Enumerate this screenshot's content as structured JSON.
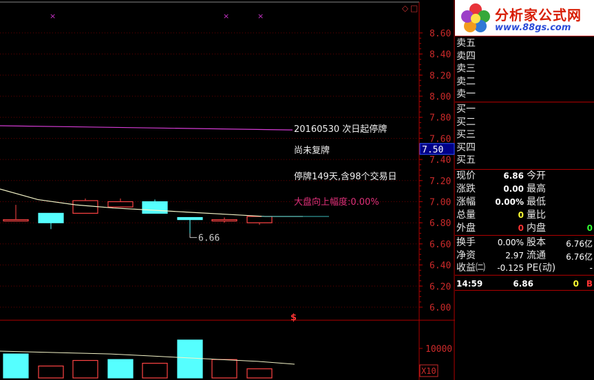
{
  "chart": {
    "price_axis": [
      "8.60",
      "8.40",
      "8.20",
      "8.00",
      "7.80",
      "7.60",
      "7.40",
      "7.20",
      "7.00",
      "6.80",
      "6.60",
      "6.40",
      "6.20",
      "6.00"
    ],
    "current_price_tag": "7.50",
    "volume_axis_label": "10000",
    "volume_scale": "X10",
    "low_marker": "6.66",
    "annotations": {
      "suspend_date": "20160530 次日起停牌",
      "not_resumed": "尚未复牌",
      "suspend_days": "停牌149天,含98个交易日",
      "market_change": "大盘向上幅度:0.00%"
    },
    "markers": [
      "×",
      "×",
      "×"
    ],
    "dollar_mark": "$",
    "corner_icons": [
      "◇",
      "□"
    ]
  },
  "chart_data": {
    "type": "candlestick",
    "candles": [
      {
        "open": 6.83,
        "close": 6.83,
        "high": 6.97,
        "low": 6.83
      },
      {
        "open": 6.89,
        "close": 6.8,
        "high": 6.89,
        "low": 6.74
      },
      {
        "open": 6.89,
        "close": 7.01,
        "high": 7.03,
        "low": 6.89
      },
      {
        "open": 6.95,
        "close": 7.0,
        "high": 7.03,
        "low": 6.95
      },
      {
        "open": 7.0,
        "close": 6.89,
        "high": 7.02,
        "low": 6.89
      },
      {
        "open": 6.85,
        "close": 6.83,
        "high": 6.85,
        "low": 6.66
      },
      {
        "open": 6.82,
        "close": 6.83,
        "high": 6.85,
        "low": 6.8
      },
      {
        "open": 6.8,
        "close": 6.86,
        "high": 6.86,
        "low": 6.78
      }
    ],
    "ma_long": {
      "start": 7.72,
      "end": 7.68
    },
    "ma_short": [
      7.12,
      7.02,
      6.97,
      6.94,
      6.92,
      6.9,
      6.88,
      6.86,
      6.86
    ],
    "volume": [
      {
        "value": 9400,
        "up": false
      },
      {
        "value": 8100,
        "up": true
      },
      {
        "value": 8700,
        "up": true
      },
      {
        "value": 8800,
        "up": false
      },
      {
        "value": 8400,
        "up": true
      },
      {
        "value": 10900,
        "up": false
      },
      {
        "value": 8800,
        "up": true
      },
      {
        "value": 7800,
        "up": true
      },
      {
        "value": 150,
        "up": true
      }
    ],
    "volume_ma": [
      9700,
      9600,
      9500,
      9400,
      9200,
      9000,
      8800,
      8600,
      8300
    ],
    "ylim": [
      6.0,
      8.6
    ]
  },
  "panel": {
    "logo_text": "分析家公式网",
    "logo_url": "www.88gs.com",
    "sell": [
      "卖五",
      "卖四",
      "卖三",
      "卖二",
      "卖一"
    ],
    "buy": [
      "买一",
      "买二",
      "买三",
      "买四",
      "买五"
    ],
    "quote": [
      {
        "l": "现价",
        "v": "6.86",
        "vc": "#ffffff",
        "r": "今开",
        "rv": "",
        "rc": "#ffffff"
      },
      {
        "l": "涨跌",
        "v": "0.00",
        "vc": "#ffffff",
        "r": "最高",
        "rv": "",
        "rc": "#ffffff"
      },
      {
        "l": "涨幅",
        "v": "0.00%",
        "vc": "#ffffff",
        "r": "最低",
        "rv": "",
        "rc": "#ffffff"
      },
      {
        "l": "总量",
        "v": "0",
        "vc": "#ffff33",
        "r": "量比",
        "rv": "",
        "rc": "#ffffff"
      },
      {
        "l": "外盘",
        "v": "0",
        "vc": "#ff3333",
        "r": "内盘",
        "rv": "0",
        "rc": "#33ff33"
      }
    ],
    "fin": [
      {
        "l": "换手",
        "v": "0.00%",
        "r": "股本",
        "rv": "6.76亿"
      },
      {
        "l": "净资",
        "v": "2.97",
        "r": "流通",
        "rv": "6.76亿"
      },
      {
        "l": "收益㈡",
        "v": "-0.125",
        "r": "PE(动)",
        "rv": "-"
      }
    ],
    "tick": {
      "time": "14:59",
      "price": "6.86",
      "vol": "0",
      "flag": "B"
    }
  }
}
